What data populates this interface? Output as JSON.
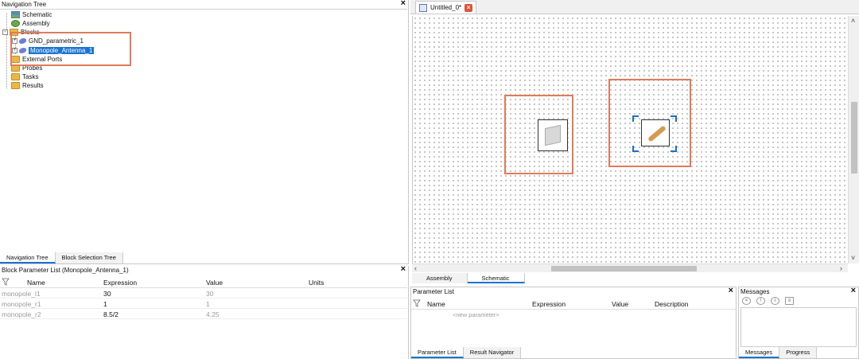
{
  "nav_tree": {
    "title": "Navigation Tree",
    "items": [
      {
        "label": "Schematic",
        "icon": "schematic-icon"
      },
      {
        "label": "Assembly",
        "icon": "assembly-icon"
      },
      {
        "label": "Blocks",
        "icon": "folder-icon"
      },
      {
        "label": "GND_parametric_1",
        "icon": "block-icon"
      },
      {
        "label": "Monopole_Antenna_1",
        "icon": "block-icon"
      },
      {
        "label": "External Ports",
        "icon": "folder-icon"
      },
      {
        "label": "Probes",
        "icon": "folder-icon"
      },
      {
        "label": "Tasks",
        "icon": "folder-icon"
      },
      {
        "label": "Results",
        "icon": "folder-icon"
      }
    ],
    "tabs": [
      "Navigation Tree",
      "Block Selection Tree"
    ]
  },
  "block_params": {
    "title": "Block Parameter List (Monopole_Antenna_1)",
    "columns": [
      "Name",
      "Expression",
      "Value",
      "Units"
    ],
    "rows": [
      {
        "name": "monopole_l1",
        "expression": "30",
        "value": "30",
        "units": ""
      },
      {
        "name": "monopole_r1",
        "expression": "1",
        "value": "1",
        "units": ""
      },
      {
        "name": "monopole_r2",
        "expression": "8.5/2",
        "value": "4.25",
        "units": ""
      }
    ]
  },
  "document": {
    "tab_label": "Untitled_0*",
    "view_tabs": [
      "Assembly",
      "Schematic"
    ]
  },
  "param_list": {
    "title": "Parameter List",
    "columns": [
      "Name",
      "Expression",
      "Value",
      "Description"
    ],
    "new_param_placeholder": "<new parameter>",
    "tabs": [
      "Parameter List",
      "Result Navigator"
    ]
  },
  "messages": {
    "title": "Messages",
    "tabs": [
      "Messages",
      "Progress"
    ]
  },
  "colors": {
    "highlight": "#e07b5a",
    "selection": "#1b74d0",
    "folder": "#e9b64a"
  }
}
